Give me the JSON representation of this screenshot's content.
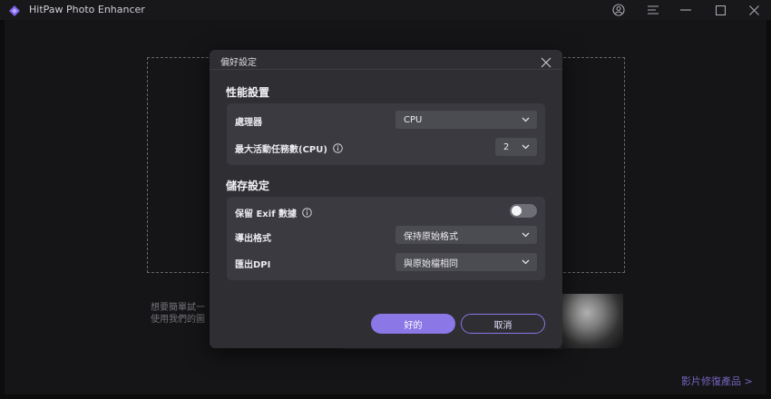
{
  "window": {
    "title": "HitPaw Photo Enhancer"
  },
  "background": {
    "hint_line1": "想要簡單試一",
    "hint_line2": "使用我們的圖",
    "link": "影片修復產品 >"
  },
  "dialog": {
    "title": "偏好設定",
    "performance": {
      "heading": "性能設置",
      "processor_label": "處理器",
      "processor_value": "CPU",
      "max_tasks_label": "最大活動任務數(CPU)",
      "max_tasks_value": "2"
    },
    "storage": {
      "heading": "儲存設定",
      "exif_label": "保留 Exif 數據",
      "exif_enabled": false,
      "format_label": "導出格式",
      "format_value": "保持原始格式",
      "dpi_label": "匯出DPI",
      "dpi_value": "與原始檔相同"
    },
    "ok_label": "好的",
    "cancel_label": "取消"
  },
  "colors": {
    "accent": "#8b77e6",
    "dialog_bg": "#2e2e33",
    "card_bg": "#3a3a40"
  }
}
